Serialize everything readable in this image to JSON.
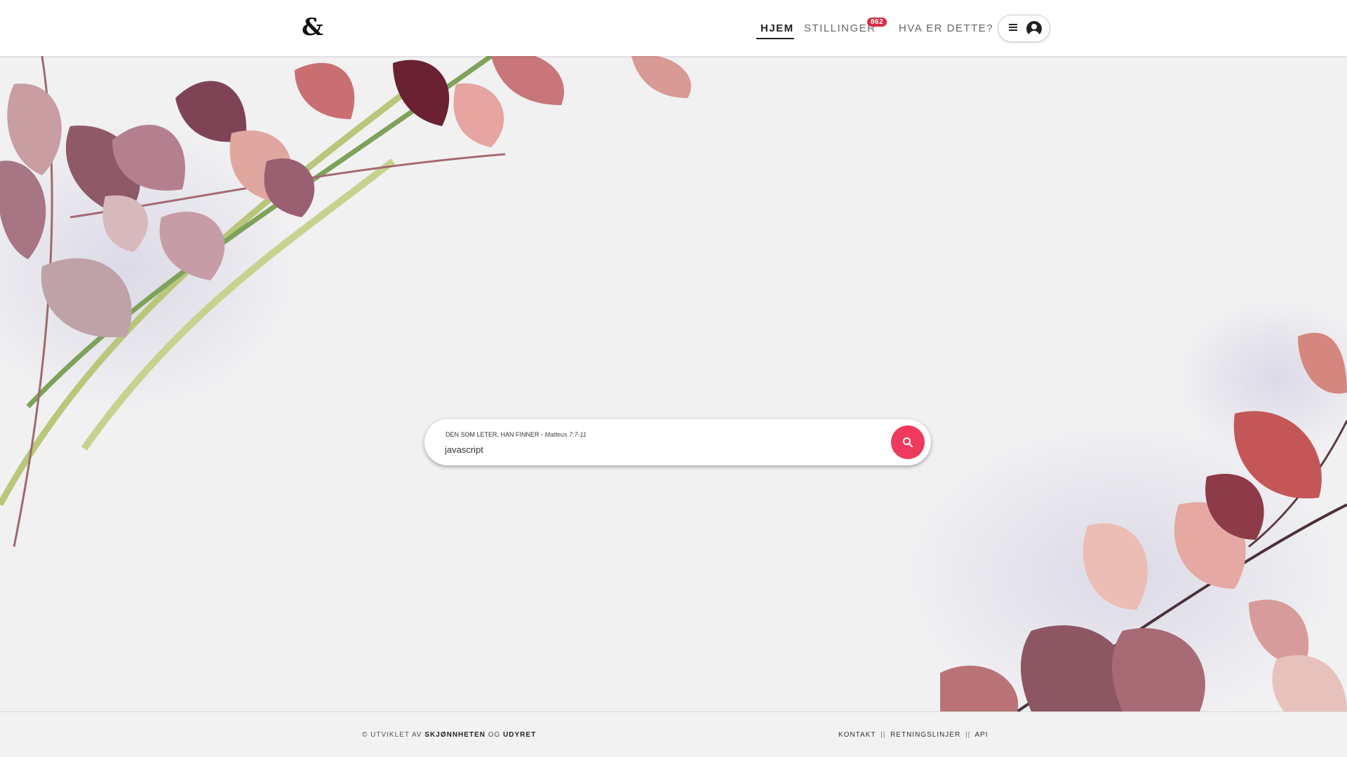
{
  "header": {
    "logo": "&",
    "nav": {
      "home": "HJEM",
      "jobs": "STILLINGER",
      "jobs_badge": "862",
      "about": "HVA ER DETTE?"
    },
    "account_icons": [
      "menu-icon",
      "user-icon"
    ]
  },
  "search": {
    "label": "DEN SOM LETER, HAN FINNER - ",
    "label_ref": "Matteus 7:7-11",
    "value": "javascript",
    "button_color": "#ef3a5d",
    "button_icon": "search-icon"
  },
  "footer": {
    "credit_prefix": "© UTVIKLET AV ",
    "credit_name1": "SKJØNNHETEN",
    "credit_mid": " OG ",
    "credit_name2": "UDYRET",
    "links": [
      "KONTAKT",
      "RETNINGSLINJER",
      "API"
    ],
    "separator": "||"
  },
  "colors": {
    "accent": "#ef3a5d",
    "badge": "#d42e45"
  }
}
